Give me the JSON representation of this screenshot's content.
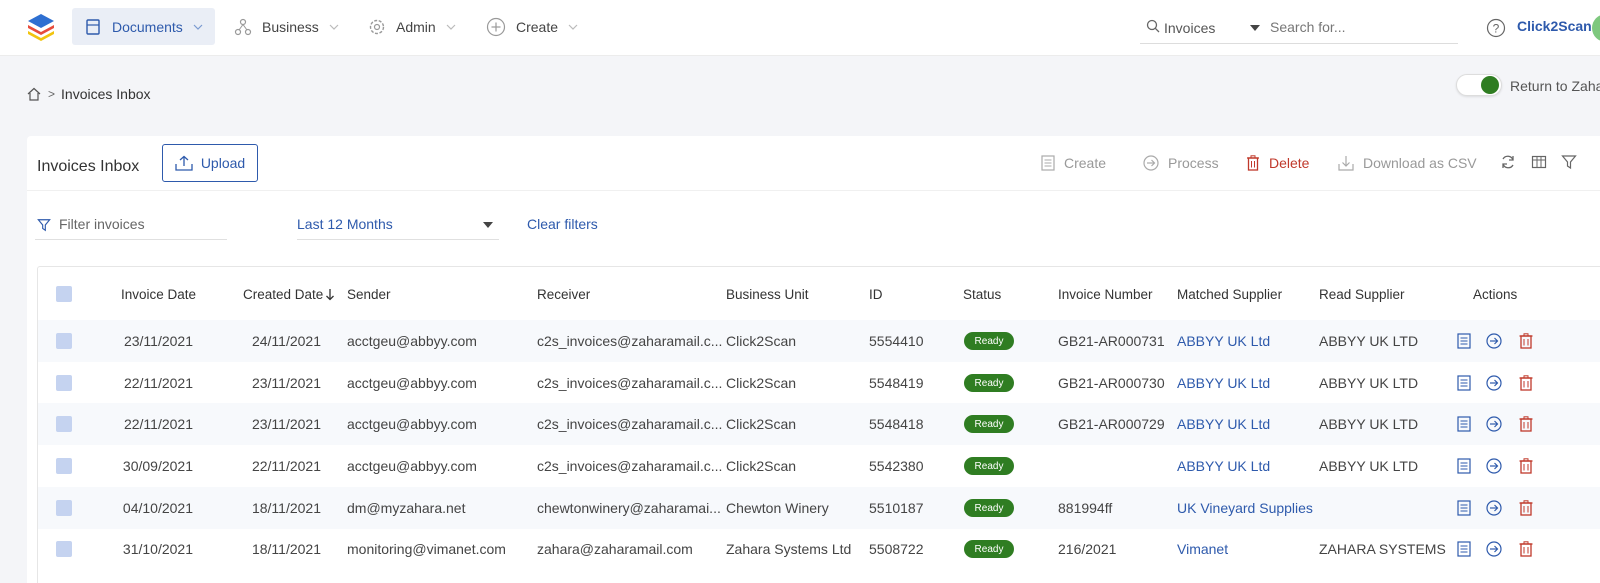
{
  "nav": {
    "items": [
      {
        "label": "Documents",
        "icon": "document-icon",
        "active": true
      },
      {
        "label": "Business",
        "icon": "network-icon",
        "active": false
      },
      {
        "label": "Admin",
        "icon": "gear-icon",
        "active": false
      },
      {
        "label": "Create",
        "icon": "plus-circle-icon",
        "active": false
      }
    ],
    "search_scope": "Invoices",
    "search_placeholder": "Search for...",
    "brand": "Click2Scan"
  },
  "breadcrumb": {
    "current": "Invoices Inbox"
  },
  "return_toggle": {
    "label": "Return to Zahara",
    "on": true
  },
  "panel": {
    "title": "Invoices Inbox",
    "upload_label": "Upload",
    "toolbar": {
      "create": "Create",
      "process": "Process",
      "delete": "Delete",
      "download_csv": "Download as CSV"
    },
    "filter_placeholder": "Filter invoices",
    "date_range": "Last 12 Months",
    "clear_filters": "Clear filters"
  },
  "table": {
    "headers": {
      "invoice_date": "Invoice Date",
      "created_date": "Created Date",
      "sender": "Sender",
      "receiver": "Receiver",
      "business_unit": "Business Unit",
      "id": "ID",
      "status": "Status",
      "invoice_number": "Invoice Number",
      "matched_supplier": "Matched Supplier",
      "read_supplier": "Read Supplier",
      "actions": "Actions"
    },
    "rows": [
      {
        "invoice_date": "23/11/2021",
        "created_date": "24/11/2021",
        "sender": "acctgeu@abbyy.com",
        "receiver": "c2s_invoices@zaharamail.c...",
        "business_unit": "Click2Scan",
        "id": "5554410",
        "status": "Ready",
        "invoice_number": "GB21-AR000731",
        "matched_supplier": "ABBYY UK Ltd",
        "read_supplier": "ABBYY UK LTD"
      },
      {
        "invoice_date": "22/11/2021",
        "created_date": "23/11/2021",
        "sender": "acctgeu@abbyy.com",
        "receiver": "c2s_invoices@zaharamail.c...",
        "business_unit": "Click2Scan",
        "id": "5548419",
        "status": "Ready",
        "invoice_number": "GB21-AR000730",
        "matched_supplier": "ABBYY UK Ltd",
        "read_supplier": "ABBYY UK LTD"
      },
      {
        "invoice_date": "22/11/2021",
        "created_date": "23/11/2021",
        "sender": "acctgeu@abbyy.com",
        "receiver": "c2s_invoices@zaharamail.c...",
        "business_unit": "Click2Scan",
        "id": "5548418",
        "status": "Ready",
        "invoice_number": "GB21-AR000729",
        "matched_supplier": "ABBYY UK Ltd",
        "read_supplier": "ABBYY UK LTD"
      },
      {
        "invoice_date": "30/09/2021",
        "created_date": "22/11/2021",
        "sender": "acctgeu@abbyy.com",
        "receiver": "c2s_invoices@zaharamail.c...",
        "business_unit": "Click2Scan",
        "id": "5542380",
        "status": "Ready",
        "invoice_number": "",
        "matched_supplier": "ABBYY UK Ltd",
        "read_supplier": "ABBYY UK LTD"
      },
      {
        "invoice_date": "04/10/2021",
        "created_date": "18/11/2021",
        "sender": "dm@myzahara.net",
        "receiver": "chewtonwinery@zaharamai...",
        "business_unit": "Chewton Winery",
        "id": "5510187",
        "status": "Ready",
        "invoice_number": "881994ff",
        "matched_supplier": "UK Vineyard Supplies",
        "read_supplier": ""
      },
      {
        "invoice_date": "31/10/2021",
        "created_date": "18/11/2021",
        "sender": "monitoring@vimanet.com",
        "receiver": "zahara@zaharamail.com",
        "business_unit": "Zahara Systems Ltd",
        "id": "5508722",
        "status": "Ready",
        "invoice_number": "216/2021",
        "matched_supplier": "Vimanet",
        "read_supplier": "ZAHARA SYSTEMS"
      }
    ]
  },
  "colors": {
    "accent": "#2e5aac",
    "ready": "#2f7d22",
    "delete": "#c0392b"
  }
}
